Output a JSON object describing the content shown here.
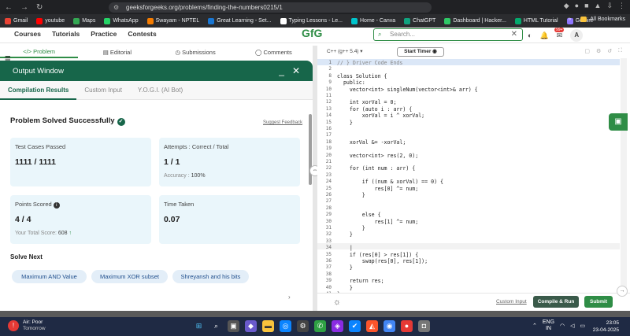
{
  "browser": {
    "url": "geeksforgeeks.org/problems/finding-the-numbers0215/1",
    "bookmarks": [
      "Gmail",
      "youtube",
      "Maps",
      "WhatsApp",
      "Swayam - NPTEL",
      "Great Learning - Set...",
      "Typing Lessons - Le...",
      "Home - Canva",
      "ChatGPT",
      "Dashboard | Hacker...",
      "HTML Tutorial",
      "Gemini"
    ],
    "bookmarks_more": "»",
    "all_bookmarks": "All Bookmarks"
  },
  "site": {
    "nav": [
      "Courses",
      "Tutorials",
      "Practice",
      "Contests"
    ],
    "logo": "GfG",
    "search_placeholder": "Search...",
    "avatar": "A",
    "notif_count": "99+"
  },
  "problem_tabs": [
    "Problem",
    "Editorial",
    "Submissions",
    "Comments"
  ],
  "output": {
    "title": "Output Window",
    "minimize": "_",
    "close": "✕",
    "tabs": [
      "Compilation Results",
      "Custom Input",
      "Y.O.G.I. (AI Bot)"
    ],
    "status": "Problem Solved Successfully",
    "feedback": "Suggest Feedback",
    "test_cases_label": "Test Cases Passed",
    "test_cases_value": "1111 / 1111",
    "attempts_label": "Attempts : Correct / Total",
    "attempts_value": "1 / 1",
    "accuracy_label": "Accuracy :",
    "accuracy_value": "100%",
    "points_label": "Points Scored",
    "points_value": "4 / 4",
    "total_score_label": "Your Total Score:",
    "total_score_value": "608",
    "time_label": "Time Taken",
    "time_value": "0.07",
    "solve_next_title": "Solve Next",
    "solve_next": [
      "Maximum AND Value",
      "Maximum XOR subset",
      "Shreyansh and his bits"
    ]
  },
  "editor": {
    "language": "C++ (g++ 5.4)",
    "timer": "Start Timer",
    "lines": [
      {
        "n": "1",
        "t": "// } Driver Code Ends"
      },
      {
        "n": "2",
        "t": ""
      },
      {
        "n": "8",
        "t": "class Solution {"
      },
      {
        "n": "9",
        "t": "  public:"
      },
      {
        "n": "10",
        "t": "    vector<int> singleNum(vector<int>& arr) {"
      },
      {
        "n": "11",
        "t": ""
      },
      {
        "n": "12",
        "t": "    int xorVal = 0;"
      },
      {
        "n": "13",
        "t": "    for (auto i : arr) {"
      },
      {
        "n": "14",
        "t": "        xorVal = i ^ xorVal;"
      },
      {
        "n": "15",
        "t": "    }"
      },
      {
        "n": "16",
        "t": ""
      },
      {
        "n": "17",
        "t": ""
      },
      {
        "n": "18",
        "t": "    xorVal &= -xorVal;"
      },
      {
        "n": "19",
        "t": ""
      },
      {
        "n": "20",
        "t": "    vector<int> res(2, 0);"
      },
      {
        "n": "21",
        "t": ""
      },
      {
        "n": "22",
        "t": "    for (int num : arr) {"
      },
      {
        "n": "23",
        "t": ""
      },
      {
        "n": "24",
        "t": "        if ((num & xorVal) == 0) {"
      },
      {
        "n": "25",
        "t": "            res[0] ^= num;"
      },
      {
        "n": "26",
        "t": "        }"
      },
      {
        "n": "27",
        "t": ""
      },
      {
        "n": "28",
        "t": ""
      },
      {
        "n": "29",
        "t": "        else {"
      },
      {
        "n": "30",
        "t": "            res[1] ^= num;"
      },
      {
        "n": "31",
        "t": "        }"
      },
      {
        "n": "32",
        "t": "    }"
      },
      {
        "n": "33",
        "t": ""
      },
      {
        "n": "34",
        "t": "    |"
      },
      {
        "n": "35",
        "t": "    if (res[0] > res[1]) {"
      },
      {
        "n": "36",
        "t": "        swap(res[0], res[1]);"
      },
      {
        "n": "37",
        "t": "    }"
      },
      {
        "n": "38",
        "t": ""
      },
      {
        "n": "39",
        "t": "    return res;"
      },
      {
        "n": "40",
        "t": "    }"
      },
      {
        "n": "41",
        "t": "};"
      }
    ],
    "custom_input": "Custom Input",
    "compile": "Compile & Run",
    "submit": "Submit"
  },
  "taskbar": {
    "weather_title": "Air: Poor",
    "weather_sub": "Tomorrow",
    "lang": "ENG",
    "region": "IN",
    "time": "23:05",
    "date": "23-04-2025"
  },
  "colors": {
    "brand": "#2f8d46",
    "output_header": "#17664a",
    "card": "#eaf6fb"
  }
}
